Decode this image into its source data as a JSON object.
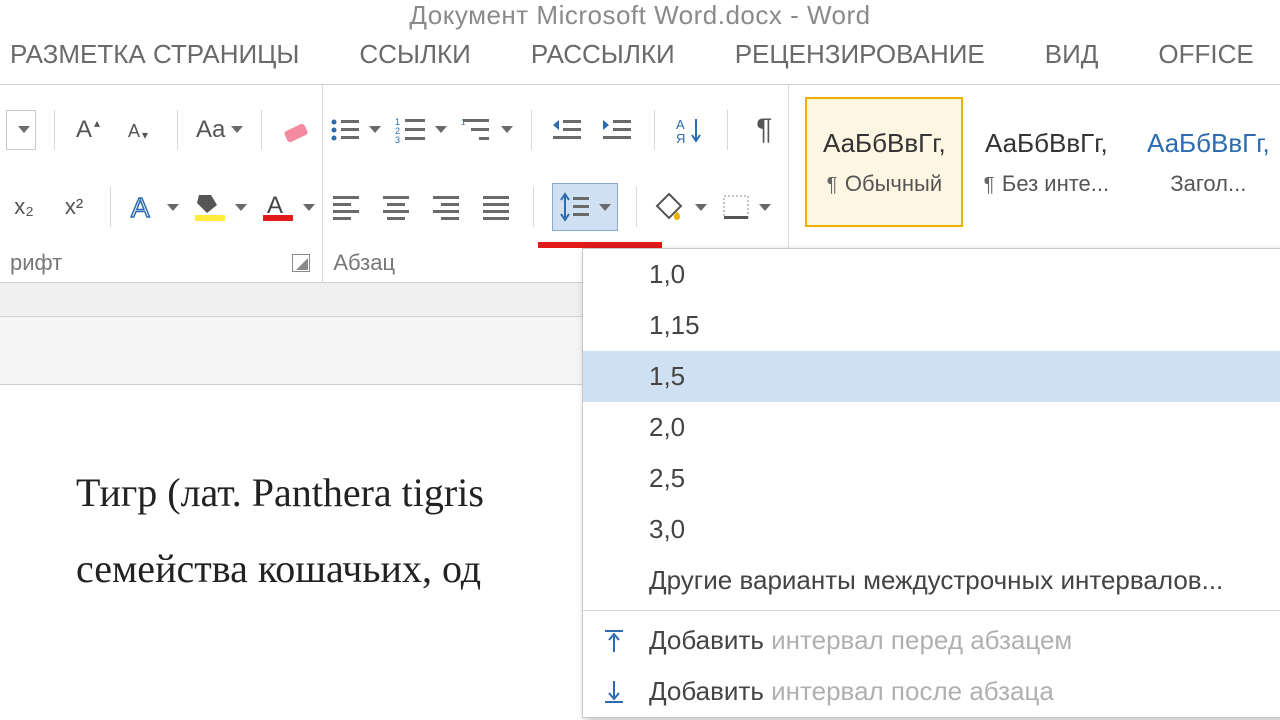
{
  "title": "Документ Microsoft Word.docx - Word",
  "tabs": [
    "РАЗМЕТКА СТРАНИЦЫ",
    "ССЫЛКИ",
    "РАССЫЛКИ",
    "РЕЦЕНЗИРОВАНИЕ",
    "ВИД",
    "OFFICE"
  ],
  "group_labels": {
    "font": "рифт",
    "para": "Абзац"
  },
  "font_group": {
    "change_case": "Aa"
  },
  "subsup": {
    "sub": "x₂",
    "sup": "x²"
  },
  "styles": [
    {
      "sample": "АаБбВвГг,",
      "name": "Обычный"
    },
    {
      "sample": "АаБбВвГг,",
      "name": "Без инте..."
    },
    {
      "sample": "АаБбВвГг,",
      "name": "Загол..."
    }
  ],
  "pilcrow_prefix": "¶ ",
  "spacing_menu": {
    "options": [
      "1,0",
      "1,15",
      "1,5",
      "2,0",
      "2,5",
      "3,0"
    ],
    "hover_index": 2,
    "more": "Другие варианты междустрочных интервалов...",
    "add_before": "Добавить интервал перед абзацем",
    "add_after": "Добавить интервал после абзаца",
    "add_prefix": "Добавить "
  },
  "document": {
    "line1": "Тигр (лат. Panthera tigris",
    "line2": "семейства кошачьих, од"
  }
}
